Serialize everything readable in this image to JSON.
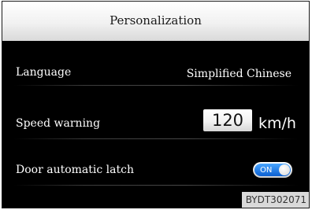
{
  "header": {
    "title": "Personalization"
  },
  "settings": {
    "language": {
      "label": "Language",
      "value": "Simplified Chinese"
    },
    "speed_warning": {
      "label": "Speed warning",
      "value": "120",
      "unit": "km/h"
    },
    "door_latch": {
      "label": "Door automatic latch",
      "toggle_text": "ON",
      "state": "on"
    }
  },
  "watermark": "BYDT302071",
  "colors": {
    "header_bg": "#f1f1f1",
    "screen_bg": "#000000",
    "toggle_on": "#1f7ae8"
  }
}
